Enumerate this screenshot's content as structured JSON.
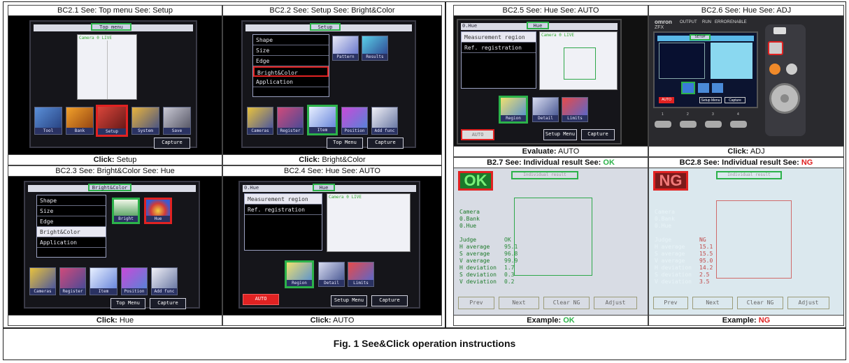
{
  "figure_caption": "Fig. 1 See&Click operation instructions",
  "panels": {
    "bc21": {
      "title": "BC2.1 See: Top menu See: Setup",
      "foot_prefix": "Click:",
      "foot_value": "Setup",
      "menu_label": "Top menu",
      "preview_caption": "Camera 0 LIVE",
      "icons": [
        "Tool",
        "Bank",
        "Setup",
        "System",
        "Save"
      ],
      "capture": "Capture"
    },
    "bc22": {
      "title": "BC2.2 See: Setup See: Bright&Color",
      "foot_prefix": "Click:",
      "foot_value": "Bright&Color",
      "menu_label": "Setup",
      "list": [
        "Shape",
        "Size",
        "Edge",
        "Bright&Color",
        "Application"
      ],
      "thumbs": [
        "Pattern",
        "Results"
      ],
      "icons": [
        "Cameras",
        "Register",
        "Item",
        "Position",
        "Add func"
      ],
      "top_menu": "Top Menu",
      "capture": "Capture"
    },
    "bc23": {
      "title": "BC2.3 See: Bright&Color See: Hue",
      "foot_prefix": "Click:",
      "foot_value": "Hue",
      "menu_label": "Bright&Color",
      "list": [
        "Shape",
        "Size",
        "Edge",
        "Bright&Color",
        "Application"
      ],
      "thumbs": [
        "Bright",
        "Hue"
      ],
      "icons": [
        "Cameras",
        "Register",
        "Item",
        "Position",
        "Add func"
      ],
      "top_menu": "Top Menu",
      "capture": "Capture"
    },
    "bc24": {
      "title": "BC2.4 See: Hue See: AUTO",
      "foot_prefix": "Click:",
      "foot_value": "AUTO",
      "menu_label": "Hue",
      "item_label": "0.Hue",
      "list": [
        "Measurement region",
        "Ref. registration"
      ],
      "preview_caption": "Camera 0 LIVE",
      "icons": [
        "Region",
        "Detail",
        "Limits"
      ],
      "auto": "AUTO",
      "setup_menu": "Setup Menu",
      "capture": "Capture"
    },
    "bc25": {
      "title": "BC2.5 See: Hue See: AUTO",
      "foot_prefix": "Evaluate:",
      "foot_value": "AUTO",
      "menu_label": "Hue",
      "item_label": "0.Hue",
      "list": [
        "Measurement region",
        "Ref. registration"
      ],
      "preview_caption": "Camera 0 LIVE",
      "icons": [
        "Region",
        "Detail",
        "Limits"
      ],
      "auto": "AUTO",
      "setup_menu": "Setup Menu",
      "capture": "Capture"
    },
    "bc26": {
      "title": "BC2.6 See: Hue See: ADJ",
      "foot_prefix": "Click:",
      "foot_value": "ADJ",
      "brand": "omron",
      "model": "ZFX",
      "leds": [
        "OUTPUT",
        "RUN",
        "ERROR",
        "ENABLE"
      ],
      "menu_label": "SETUP",
      "auto": "AUTO",
      "setup_menu": "Setup Menu",
      "capture": "Capture",
      "keys": [
        "1",
        "2",
        "3",
        "4"
      ],
      "side_keys": [
        "ESC",
        "ADJ",
        "SET"
      ]
    },
    "bc27": {
      "title_prefix": "B2.7 See: Individual result See:",
      "title_value": "OK",
      "foot_prefix": "Example:",
      "foot_value": "OK",
      "badge": "OK",
      "lines": [
        "Camera",
        "0.Bank",
        "0.Hue",
        "",
        "Judge",
        "H average",
        "S average",
        "V average",
        "H deviation",
        "S deviation",
        "V deviation"
      ],
      "values": [
        "",
        "",
        "",
        "",
        "OK",
        "95.1",
        "96.8",
        "99.9",
        "1.7",
        "0.3",
        "0.2"
      ],
      "buttons": [
        "Prev",
        "Next",
        "Clear NG",
        "Adjust"
      ],
      "top_label": "Individual result"
    },
    "bc28": {
      "title_prefix": "BC2.8 See: Individual result See:",
      "title_value": "NG",
      "foot_prefix": "Example:",
      "foot_value": "NG",
      "badge": "NG",
      "lines": [
        "Camera",
        "0.Bank",
        "0.Hue",
        "",
        "Judge",
        "H average",
        "S average",
        "V average",
        "H deviation",
        "S deviation",
        "V deviation"
      ],
      "values": [
        "",
        "",
        "",
        "",
        "NG",
        "15.1",
        "15.5",
        "95.0",
        "14.2",
        "2.5",
        "3.5"
      ],
      "buttons": [
        "Prev",
        "Next",
        "Clear NG",
        "Adjust"
      ],
      "top_label": "Individual result"
    }
  },
  "colors": {
    "ok": "#2db34a",
    "ng": "#e02020",
    "highlight_green": "#2cb24a",
    "highlight_red": "#e12222"
  }
}
